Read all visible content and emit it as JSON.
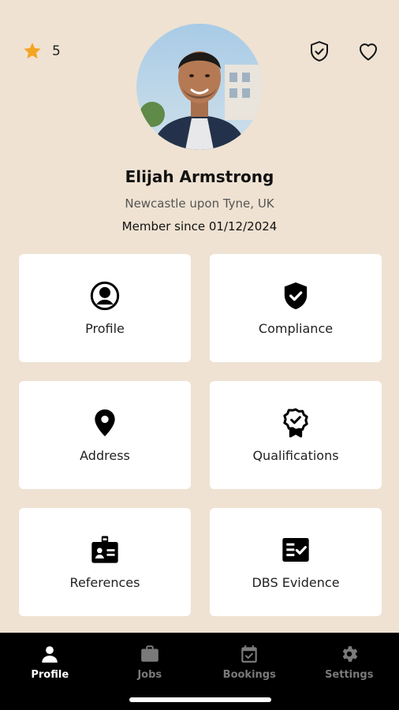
{
  "header": {
    "rating_value": "5",
    "rating_icon": "star-icon",
    "rating_color": "#f5a524",
    "actions": [
      {
        "icon": "shield-check-icon"
      },
      {
        "icon": "heart-icon"
      }
    ]
  },
  "profile": {
    "name": "Elijah Armstrong",
    "location": "Newcastle upon Tyne, UK",
    "member_since": "Member since 01/12/2024"
  },
  "tiles": [
    {
      "label": "Profile",
      "icon": "user-circle-icon"
    },
    {
      "label": "Compliance",
      "icon": "shield-check-icon"
    },
    {
      "label": "Address",
      "icon": "location-pin-icon"
    },
    {
      "label": "Qualifications",
      "icon": "award-badge-icon"
    },
    {
      "label": "References",
      "icon": "id-badge-icon"
    },
    {
      "label": "DBS Evidence",
      "icon": "checklist-icon"
    }
  ],
  "nav": {
    "items": [
      {
        "label": "Profile",
        "icon": "person-icon",
        "active": true
      },
      {
        "label": "Jobs",
        "icon": "briefcase-icon",
        "active": false
      },
      {
        "label": "Bookings",
        "icon": "calendar-check-icon",
        "active": false
      },
      {
        "label": "Settings",
        "icon": "gear-icon",
        "active": false
      }
    ],
    "active_color": "#ffffff",
    "inactive_color": "#7a7a7a",
    "background": "#000000"
  },
  "theme": {
    "background": "#efe2d2",
    "tile_background": "#ffffff"
  }
}
